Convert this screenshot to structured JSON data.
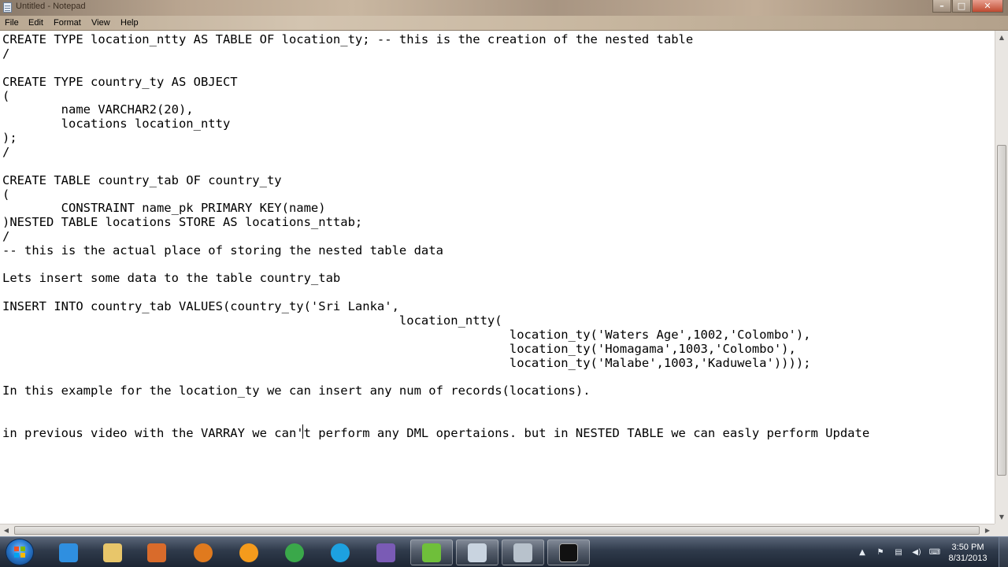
{
  "window": {
    "title": "Untitled - Notepad",
    "controls": {
      "minimize": "–",
      "maximize": "□",
      "close": "✕"
    }
  },
  "menu": {
    "items": [
      "File",
      "Edit",
      "Format",
      "View",
      "Help"
    ]
  },
  "editor": {
    "lines": [
      "CREATE TYPE location_ntty AS TABLE OF location_ty; -- this is the creation of the nested table",
      "/",
      "",
      "CREATE TYPE country_ty AS OBJECT",
      "(",
      "        name VARCHAR2(20),",
      "        locations location_ntty",
      ");",
      "/",
      "",
      "CREATE TABLE country_tab OF country_ty",
      "(",
      "        CONSTRAINT name_pk PRIMARY KEY(name)",
      ")NESTED TABLE locations STORE AS locations_nttab;",
      "/",
      "-- this is the actual place of storing the nested table data",
      "",
      "Lets insert some data to the table country_tab",
      "",
      "INSERT INTO country_tab VALUES(country_ty('Sri Lanka',",
      "                                                      location_ntty(",
      "                                                                     location_ty('Waters Age',1002,'Colombo'),",
      "                                                                     location_ty('Homagama',1003,'Colombo'),",
      "                                                                     location_ty('Malabe',1003,'Kaduwela'))));",
      "",
      "In this example for the location_ty we can insert any num of records(locations).",
      "",
      "",
      "in previous video with the VARRAY we can't perform any DML opertaions. but in NESTED TABLE we can easly perform Update"
    ]
  },
  "scrollbars": {
    "up_arrow": "▲",
    "down_arrow": "▼",
    "left_arrow": "◀",
    "right_arrow": "▶"
  },
  "taskbar": {
    "apps": [
      {
        "name": "internet-explorer",
        "color": "#2f8fe0"
      },
      {
        "name": "file-explorer",
        "color": "#e8c66a"
      },
      {
        "name": "media-player",
        "color": "#d96b2b"
      },
      {
        "name": "firefox",
        "color": "#e07a1e"
      },
      {
        "name": "vlc",
        "color": "#f59b1c"
      },
      {
        "name": "chrome",
        "color": "#3aa84a"
      },
      {
        "name": "skype",
        "color": "#1da1e0"
      },
      {
        "name": "visual-studio",
        "color": "#7a5bb5"
      },
      {
        "name": "utorrent",
        "color": "#6fbf3a"
      },
      {
        "name": "notepad",
        "color": "#c9d4e0"
      },
      {
        "name": "folder",
        "color": "#b8c2cc"
      },
      {
        "name": "command-prompt",
        "color": "#111111"
      }
    ],
    "tray": {
      "up_arrow": "▲"
    },
    "clock": {
      "time": "3:50 PM",
      "date": "8/31/2013"
    }
  },
  "colors": {
    "accent": "#2a7bd0",
    "editor_bg": "#ffffff",
    "text": "#000000"
  }
}
